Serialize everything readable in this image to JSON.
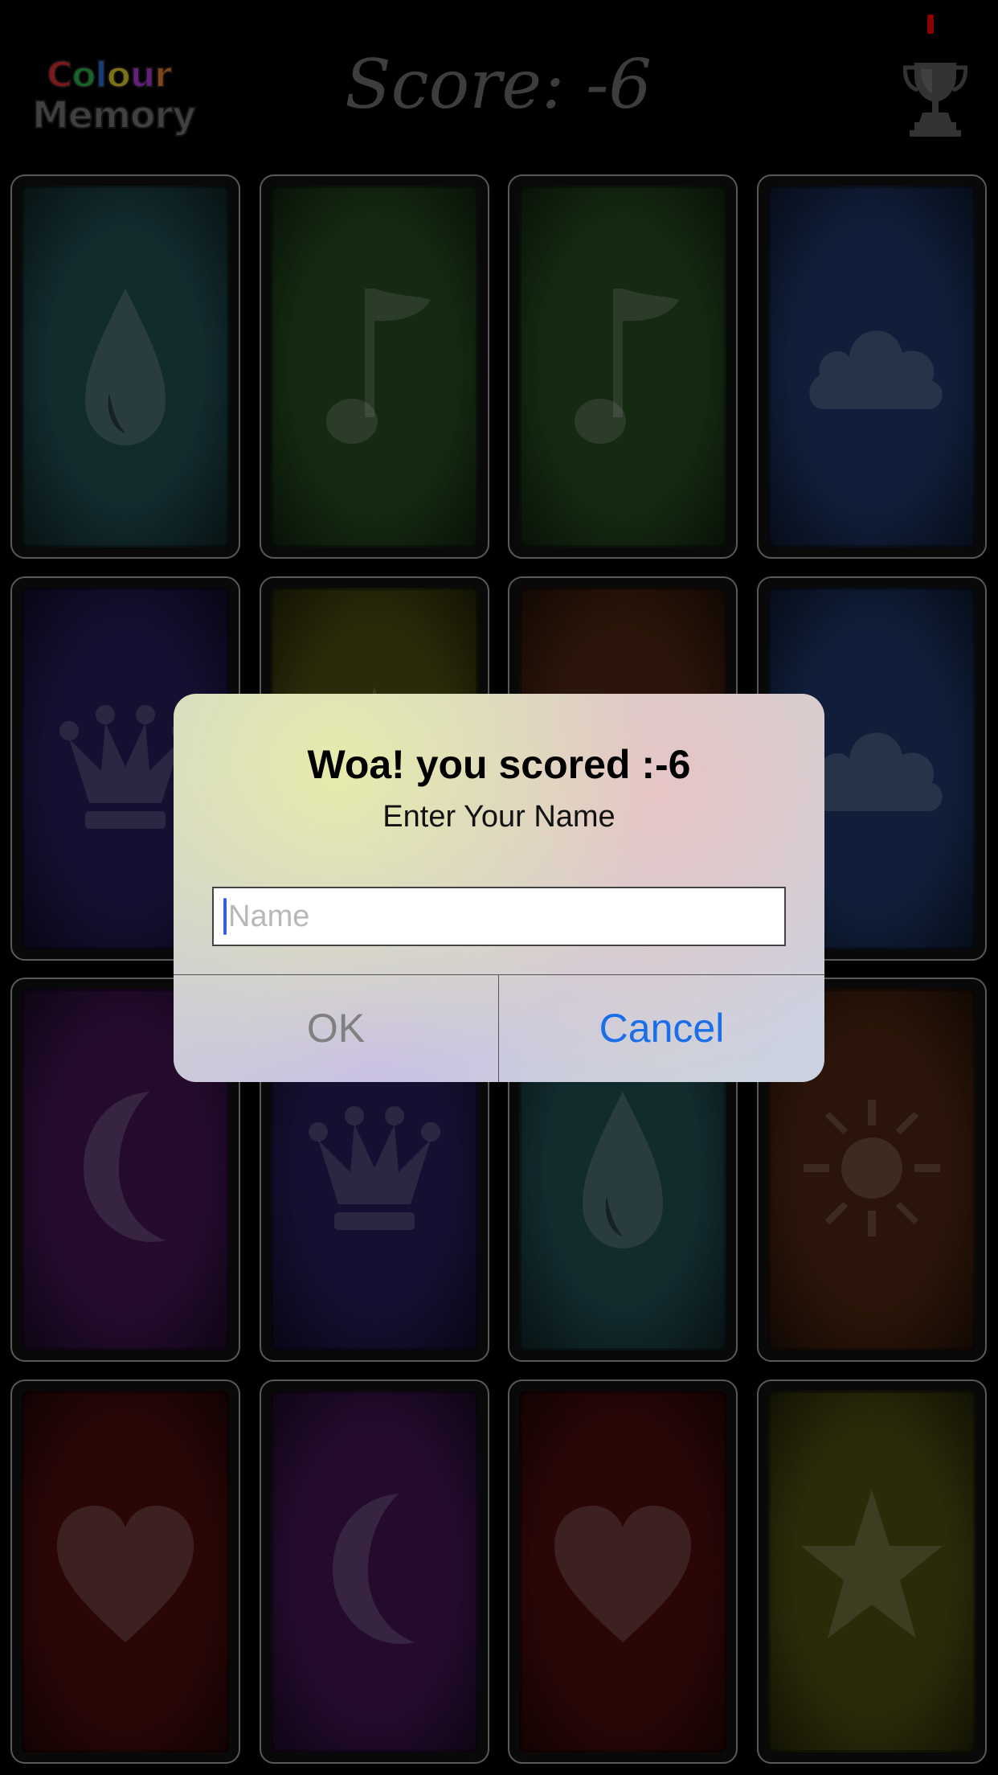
{
  "header": {
    "logo_line1": "Colour",
    "logo_line2": "Memory",
    "score_text": "Score: -6"
  },
  "cards": [
    {
      "color": "#1f4a4f",
      "icon": "drop-icon"
    },
    {
      "color": "#234a1e",
      "icon": "music-note-icon"
    },
    {
      "color": "#234a1e",
      "icon": "music-note-icon"
    },
    {
      "color": "#1c3463",
      "icon": "cloud-icon"
    },
    {
      "color": "#251a55",
      "icon": "crown-icon"
    },
    {
      "color": "#4a4a12",
      "icon": "star-icon"
    },
    {
      "color": "#4a2410",
      "icon": "sun-icon"
    },
    {
      "color": "#1c3463",
      "icon": "cloud-icon"
    },
    {
      "color": "#3e1450",
      "icon": "moon-icon"
    },
    {
      "color": "#251a55",
      "icon": "crown-icon"
    },
    {
      "color": "#1f4a4f",
      "icon": "drop-icon"
    },
    {
      "color": "#4a2410",
      "icon": "sun-icon"
    },
    {
      "color": "#4a0c0c",
      "icon": "heart-icon"
    },
    {
      "color": "#3e1450",
      "icon": "moon-icon"
    },
    {
      "color": "#4a0c0c",
      "icon": "heart-icon"
    },
    {
      "color": "#4a4a12",
      "icon": "star-icon"
    }
  ],
  "alert": {
    "title": "Woa! you scored :-6",
    "message": "Enter Your Name",
    "input_placeholder": "Name",
    "input_value": "",
    "ok_label": "OK",
    "cancel_label": "Cancel"
  },
  "colors": {
    "logo_letters": [
      "#d42a2a",
      "#2aa84a",
      "#2a6ad4",
      "#d4c42a",
      "#a83ad4",
      "#e0762a"
    ],
    "cancel_text": "#1a6fe8",
    "ok_text": "#808080"
  }
}
